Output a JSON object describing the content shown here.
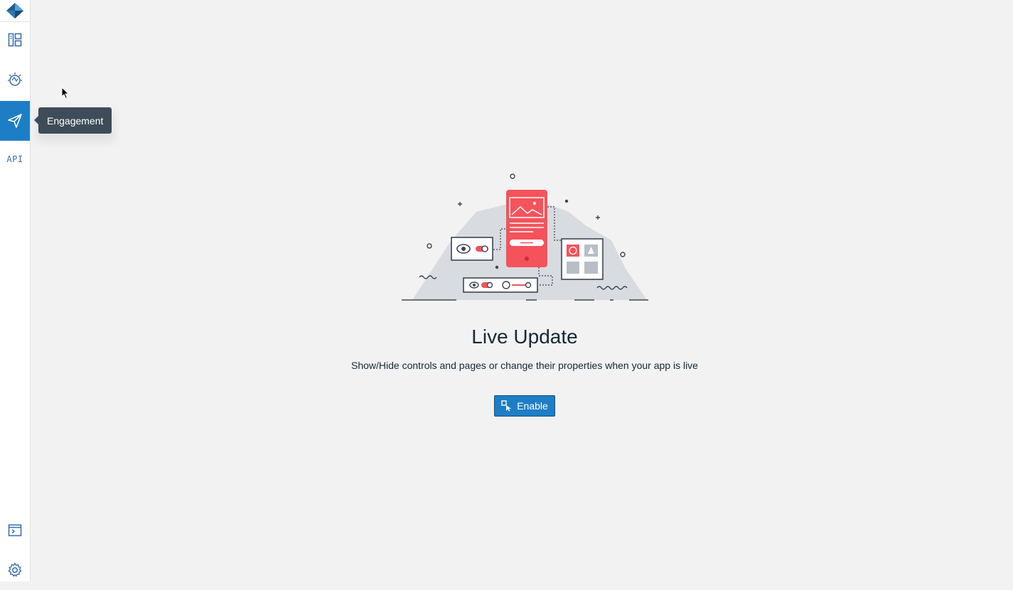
{
  "sidebar": {
    "items": [
      {
        "icon": "dashboard-icon"
      },
      {
        "icon": "analytics-bulb-icon"
      },
      {
        "icon": "engagement-paper-plane-icon",
        "active": true
      },
      {
        "icon": "api-icon",
        "label": "API"
      }
    ],
    "bottom_items": [
      {
        "icon": "terminal-icon"
      },
      {
        "icon": "gear-icon"
      }
    ]
  },
  "tooltip": {
    "text": "Engagement"
  },
  "main": {
    "title": "Live Update",
    "subtitle": "Show/Hide controls and pages or change their properties when your app is live",
    "enable_button": {
      "label": "Enable",
      "icon": "live-update-cursor-icon"
    }
  },
  "colors": {
    "accent": "#1d7ec6",
    "illustration_red": "#f4535b",
    "background": "#f2f2f2"
  }
}
